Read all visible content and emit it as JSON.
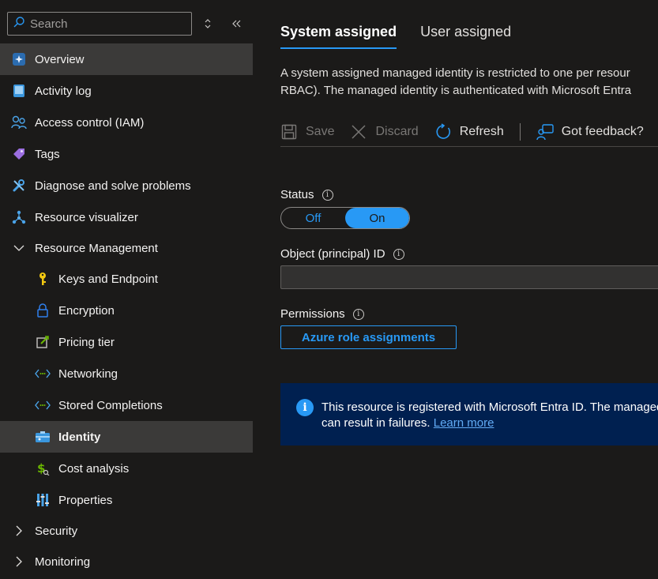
{
  "sidebar": {
    "search": {
      "placeholder": "Search"
    },
    "items": [
      {
        "label": "Overview",
        "icon": "overview-icon"
      },
      {
        "label": "Activity log",
        "icon": "activity-log-icon"
      },
      {
        "label": "Access control (IAM)",
        "icon": "access-control-icon"
      },
      {
        "label": "Tags",
        "icon": "tag-icon"
      },
      {
        "label": "Diagnose and solve problems",
        "icon": "wrench-icon"
      },
      {
        "label": "Resource visualizer",
        "icon": "hierarchy-icon"
      },
      {
        "label": "Resource Management",
        "icon": "chevron-down-icon"
      },
      {
        "label": "Keys and Endpoint",
        "icon": "key-icon"
      },
      {
        "label": "Encryption",
        "icon": "lock-icon"
      },
      {
        "label": "Pricing tier",
        "icon": "edit-icon"
      },
      {
        "label": "Networking",
        "icon": "code-arrows-icon"
      },
      {
        "label": "Stored Completions",
        "icon": "code-arrows-icon"
      },
      {
        "label": "Identity",
        "icon": "identity-icon"
      },
      {
        "label": "Cost analysis",
        "icon": "dollar-icon"
      },
      {
        "label": "Properties",
        "icon": "properties-icon"
      },
      {
        "label": "Security",
        "icon": "chevron-right-icon"
      },
      {
        "label": "Monitoring",
        "icon": "chevron-right-icon"
      }
    ]
  },
  "main": {
    "tabs": [
      {
        "label": "System assigned",
        "active": true
      },
      {
        "label": "User assigned",
        "active": false
      }
    ],
    "description_line1": "A system assigned managed identity is restricted to one per resour",
    "description_line2": "RBAC). The managed identity is authenticated with Microsoft Entra",
    "toolbar": {
      "save": "Save",
      "discard": "Discard",
      "refresh": "Refresh",
      "feedback": "Got feedback?"
    },
    "status": {
      "label": "Status",
      "off": "Off",
      "on": "On",
      "value": "On"
    },
    "object_id": {
      "label": "Object (principal) ID",
      "value": ""
    },
    "permissions": {
      "label": "Permissions",
      "button": "Azure role assignments"
    },
    "banner": {
      "line1": "This resource is registered with Microsoft Entra ID. The managed",
      "line2": "can result in failures.",
      "link": "Learn more"
    }
  },
  "colors": {
    "accent": "#2899f5",
    "background": "#1b1a19",
    "selected": "#3b3a39",
    "banner": "#002050"
  }
}
